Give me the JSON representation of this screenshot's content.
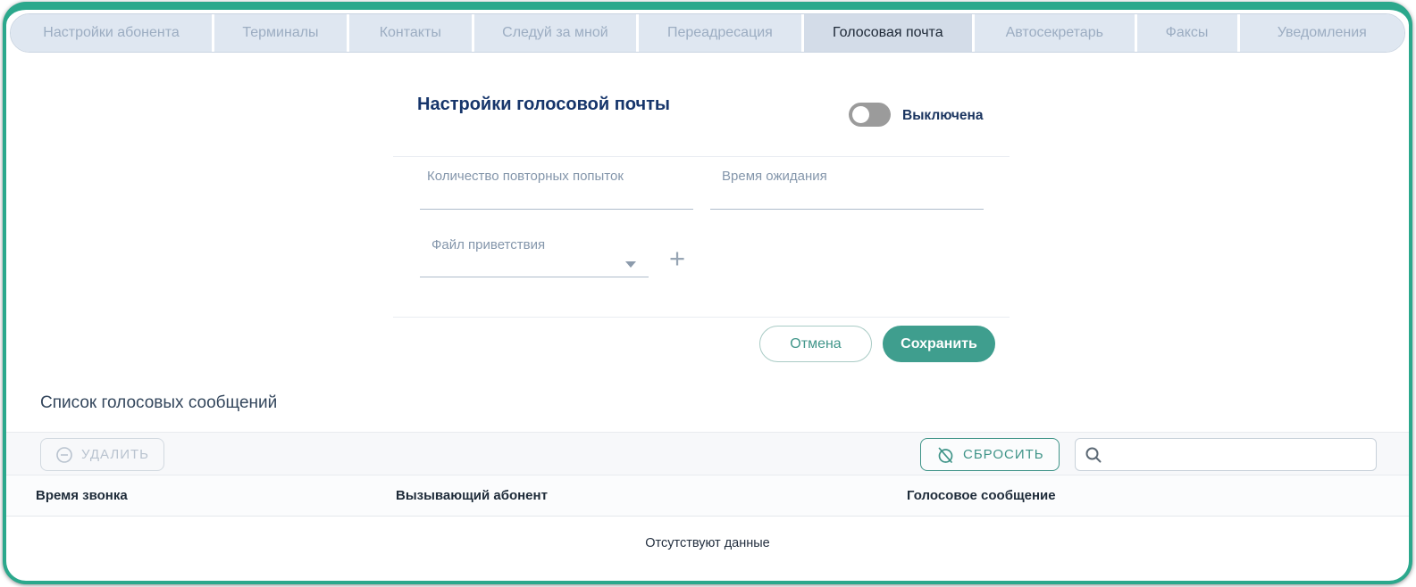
{
  "colors": {
    "accent_teal": "#2ba88c",
    "save_button_bg": "#3f9e8e",
    "reset_button_teal": "#3f9488",
    "tab_active_bg": "#d3dce8",
    "tab_inactive_bg": "#dfe7f1",
    "tab_inactive_text": "#9cadc2",
    "heading_navy": "#16356b",
    "label_gray_blue": "#8496ab",
    "toggle_track_off": "#9b9b9b",
    "toolbar_bg": "#f7f8fa"
  },
  "tabs": {
    "items": [
      {
        "label": "Настройки абонента",
        "active": false
      },
      {
        "label": "Терминалы",
        "active": false
      },
      {
        "label": "Контакты",
        "active": false
      },
      {
        "label": "Следуй за мной",
        "active": false
      },
      {
        "label": "Переадресация",
        "active": false
      },
      {
        "label": "Голосовая почта",
        "active": true
      },
      {
        "label": "Автосекретарь",
        "active": false
      },
      {
        "label": "Факсы",
        "active": false
      },
      {
        "label": "Уведомления",
        "active": false
      }
    ]
  },
  "voicemail_settings": {
    "title": "Настройки голосовой почты",
    "status_toggle": {
      "state": "off",
      "label": "Выключена"
    },
    "fields": {
      "retry_attempts": {
        "label": "Количество повторных попыток",
        "value": ""
      },
      "wait_time": {
        "label": "Время ожидания",
        "value": ""
      },
      "greeting_file": {
        "label": "Файл приветствия",
        "value": ""
      }
    },
    "actions": {
      "cancel": "Отмена",
      "save": "Сохранить"
    }
  },
  "voice_messages": {
    "title": "Список голосовых сообщений",
    "toolbar": {
      "delete_label": "УДАЛИТЬ",
      "reset_label": "СБРОСИТЬ",
      "search_value": ""
    },
    "table": {
      "columns": [
        "Время звонка",
        "Вызывающий абонент",
        "Голосовое сообщение"
      ],
      "rows": [],
      "empty_message": "Отсутствуют данные"
    }
  }
}
